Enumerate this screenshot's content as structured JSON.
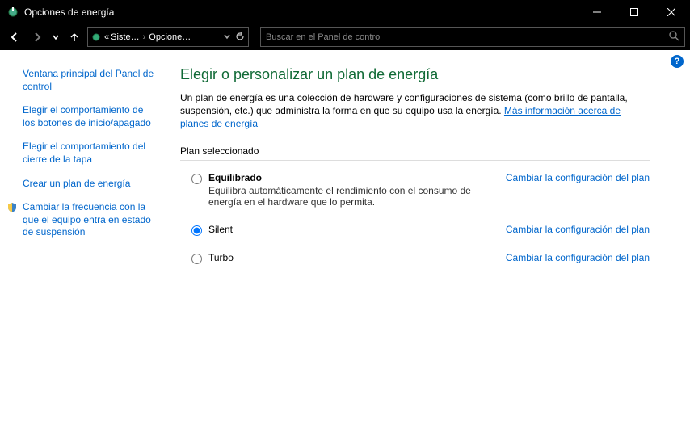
{
  "window": {
    "title": "Opciones de energía"
  },
  "address": {
    "prefix": "«",
    "crumb1": "Siste…",
    "crumb2": "Opcione…"
  },
  "search": {
    "placeholder": "Buscar en el Panel de control"
  },
  "help": {
    "label": "?"
  },
  "sidebar": {
    "items": [
      {
        "label": "Ventana principal del Panel de control"
      },
      {
        "label": "Elegir el comportamiento de los botones de inicio/apagado"
      },
      {
        "label": "Elegir el comportamiento del cierre de la tapa"
      },
      {
        "label": "Crear un plan de energía"
      },
      {
        "label": "Cambiar la frecuencia con la que el equipo entra en estado de suspensión",
        "shield": true
      }
    ]
  },
  "main": {
    "heading": "Elegir o personalizar un plan de energía",
    "desc_before": "Un plan de energía es una colección de hardware y configuraciones de sistema (como brillo de pantalla, suspensión, etc.) que administra la forma en que su equipo usa la energía. ",
    "desc_link": "Más información acerca de planes de energía",
    "group_label": "Plan seleccionado",
    "change_label": "Cambiar la configuración del plan",
    "plans": [
      {
        "name": "Equilibrado",
        "bold": true,
        "selected": false,
        "desc": "Equilibra automáticamente el rendimiento con el consumo de energía en el hardware que lo permita."
      },
      {
        "name": "Silent",
        "bold": false,
        "selected": true,
        "desc": ""
      },
      {
        "name": "Turbo",
        "bold": false,
        "selected": false,
        "desc": ""
      }
    ]
  }
}
